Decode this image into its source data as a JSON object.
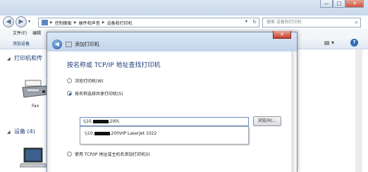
{
  "explorer": {
    "address_segments": [
      "控制面板",
      "硬件和声音",
      "设备和打印机"
    ],
    "search_placeholder": "搜索 设备和打印机",
    "menu": [
      "文件(F)",
      "编辑"
    ],
    "toolbar_item": "添加设备",
    "group_printers": "打印机和传",
    "group_devices": "设备 (4)",
    "fax_label": "Fax",
    "window_controls": {
      "minimize": "—",
      "maximize": "□",
      "close": "✕"
    }
  },
  "dialog": {
    "title": "添加打印机",
    "close": "✕",
    "heading": "按名称或 TCP/IP 地址查找打印机",
    "options": [
      {
        "label": "浏览打印机(W)",
        "selected": false
      },
      {
        "label": "按名称选择共享打印机(S)",
        "selected": true
      },
      {
        "label": "使用 TCP/IP 地址或主机名添加打印机(I)",
        "selected": false
      }
    ],
    "path_prefix": "\\\\10.",
    "path_suffix": ".200\\",
    "suggestion_prefix": "\\\\10.",
    "suggestion_suffix": ".200\\HP LaserJet 1022",
    "browse_label": "浏览(R)..."
  },
  "colors": {
    "heading": "#1e3f7a",
    "titlebar": "#c9d8ea",
    "close": "#c53f2a"
  }
}
